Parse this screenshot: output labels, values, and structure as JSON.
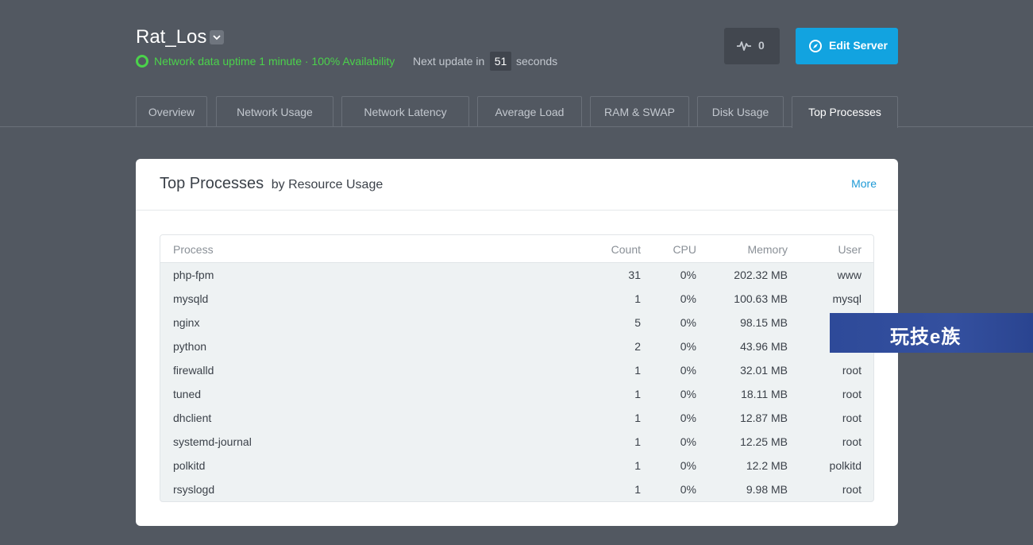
{
  "server": {
    "name": "Rat_Los",
    "status_text": "Network data uptime 1 minute · 100% Availability",
    "next_update_label": "Next update in",
    "next_update_value": "51",
    "next_update_unit": "seconds",
    "status_color": "#4bd24b"
  },
  "actions": {
    "activity_count": "0",
    "activity_icon": "pulse-icon",
    "edit_label": "Edit Server",
    "edit_icon": "compass-icon",
    "accent_color": "#12a3e0"
  },
  "tabs": [
    {
      "label": "Overview",
      "active": false
    },
    {
      "label": "Network Usage",
      "active": false
    },
    {
      "label": "Network Latency",
      "active": false
    },
    {
      "label": "Average Load",
      "active": false
    },
    {
      "label": "RAM & SWAP",
      "active": false
    },
    {
      "label": "Disk Usage",
      "active": false
    },
    {
      "label": "Top Processes",
      "active": true
    }
  ],
  "card": {
    "title": "Top Processes",
    "subtitle": "by Resource Usage",
    "more_label": "More"
  },
  "table": {
    "headers": {
      "process": "Process",
      "count": "Count",
      "cpu": "CPU",
      "memory": "Memory",
      "user": "User"
    },
    "rows": [
      {
        "process": "php-fpm",
        "count": "31",
        "cpu": "0%",
        "memory": "202.32 MB",
        "user": "www"
      },
      {
        "process": "mysqld",
        "count": "1",
        "cpu": "0%",
        "memory": "100.63 MB",
        "user": "mysql"
      },
      {
        "process": "nginx",
        "count": "5",
        "cpu": "0%",
        "memory": "98.15 MB",
        "user": ""
      },
      {
        "process": "python",
        "count": "2",
        "cpu": "0%",
        "memory": "43.96 MB",
        "user": ""
      },
      {
        "process": "firewalld",
        "count": "1",
        "cpu": "0%",
        "memory": "32.01 MB",
        "user": "root"
      },
      {
        "process": "tuned",
        "count": "1",
        "cpu": "0%",
        "memory": "18.11 MB",
        "user": "root"
      },
      {
        "process": "dhclient",
        "count": "1",
        "cpu": "0%",
        "memory": "12.87 MB",
        "user": "root"
      },
      {
        "process": "systemd-journal",
        "count": "1",
        "cpu": "0%",
        "memory": "12.25 MB",
        "user": "root"
      },
      {
        "process": "polkitd",
        "count": "1",
        "cpu": "0%",
        "memory": "12.2 MB",
        "user": "polkitd"
      },
      {
        "process": "rsyslogd",
        "count": "1",
        "cpu": "0%",
        "memory": "9.98 MB",
        "user": "root"
      }
    ]
  },
  "watermark": {
    "text": "玩技e族"
  }
}
